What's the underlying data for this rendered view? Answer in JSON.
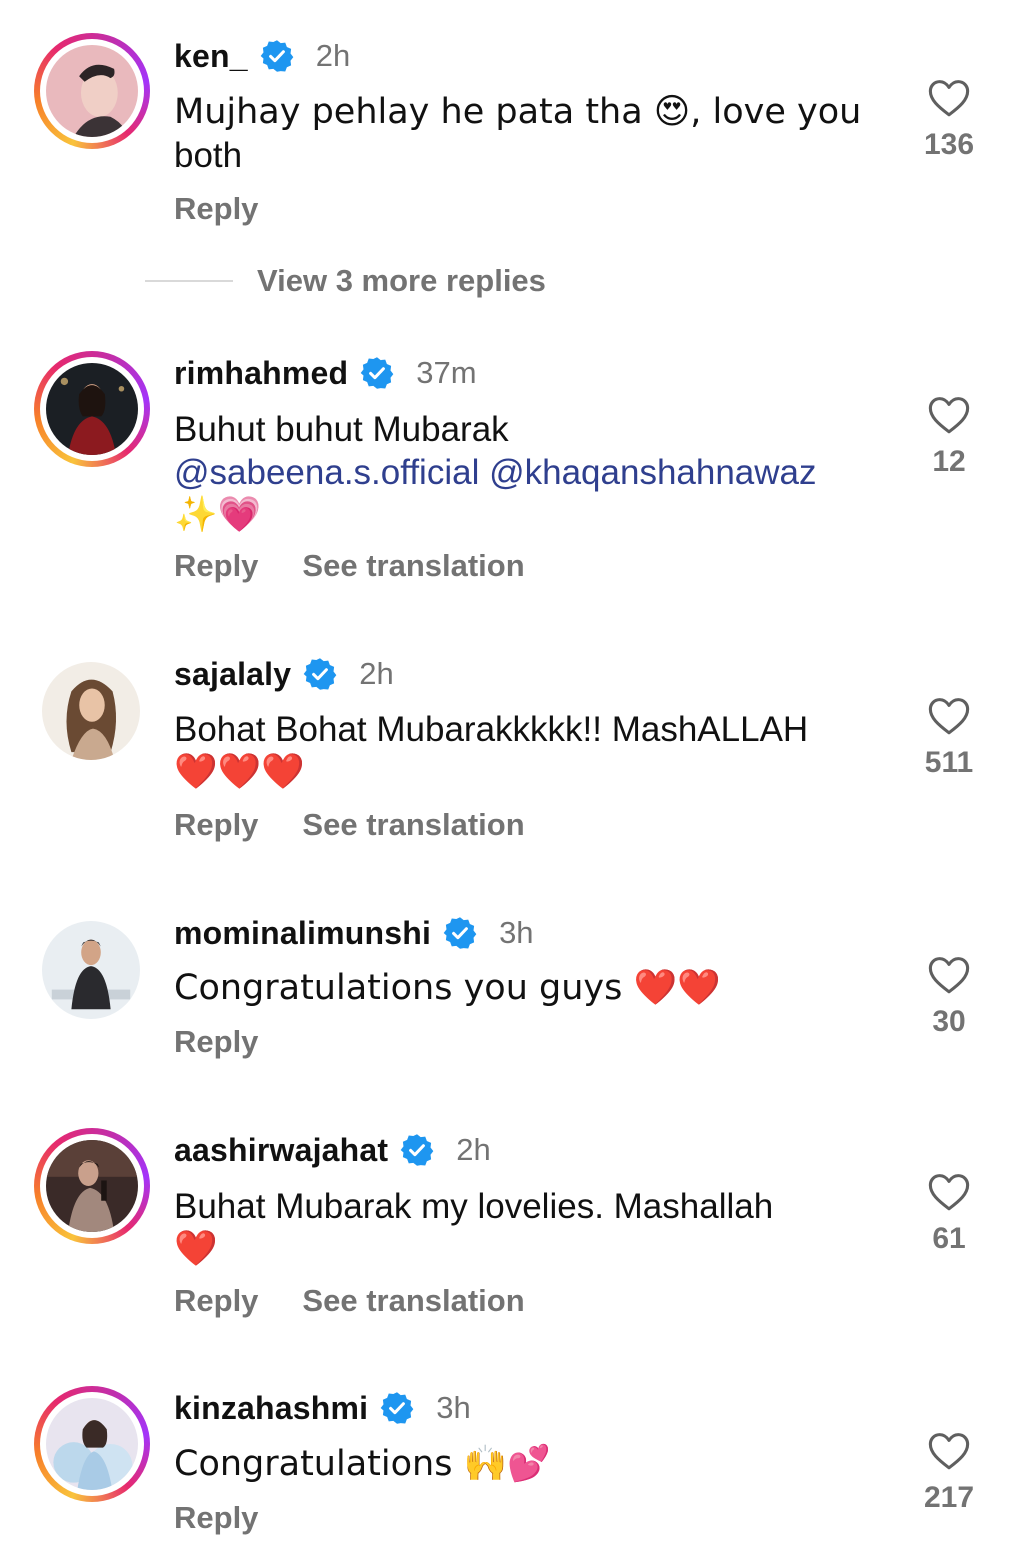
{
  "comments": [
    {
      "username": "ken_",
      "verified": true,
      "time": "2h",
      "text_lines": [
        "Mujhay pehlay he pata tha 😍, love you",
        "both"
      ],
      "reply_label": "Reply",
      "likes": "136",
      "story_ring": true,
      "avatar_colors": [
        "#e9b9bd",
        "#2c2426"
      ]
    },
    {
      "username": "rimhahmed",
      "verified": true,
      "time": "37m",
      "text_line1": "Buhut buhut Mubarak",
      "mention1": "@sabeena.s.official",
      "mention2": "@khaqanshahnawaz",
      "text_line3": "✨💗",
      "reply_label": "Reply",
      "translation_label": "See translation",
      "likes": "12",
      "story_ring": true,
      "avatar_colors": [
        "#1b1f24",
        "#8c1a1f"
      ]
    },
    {
      "username": "sajalaly",
      "verified": true,
      "time": "2h",
      "text_line1": "Bohat Bohat Mubarakkkkk!! MashALLAH",
      "text_line2": "❤️❤️❤️",
      "reply_label": "Reply",
      "translation_label": "See translation",
      "likes": "511",
      "story_ring": false,
      "avatar_colors": [
        "#f2ede6",
        "#6a4a33"
      ]
    },
    {
      "username": "mominalimunshi",
      "verified": true,
      "time": "3h",
      "text_line1": "Congratulations you guys ❤️❤️",
      "reply_label": "Reply",
      "likes": "30",
      "story_ring": false,
      "avatar_colors": [
        "#e9eef2",
        "#2a2a2e"
      ]
    },
    {
      "username": "aashirwajahat",
      "verified": true,
      "time": "2h",
      "text_line1": "Buhat Mubarak my lovelies. Mashallah",
      "text_line2": "❤️",
      "reply_label": "Reply",
      "translation_label": "See translation",
      "likes": "61",
      "story_ring": true,
      "avatar_colors": [
        "#3a2a28",
        "#a2887d"
      ]
    },
    {
      "username": "kinzahashmi",
      "verified": true,
      "time": "3h",
      "text_line1": "Congratulations 🙌💕",
      "reply_label": "Reply",
      "likes": "217",
      "story_ring": true,
      "avatar_colors": [
        "#bcd8ec",
        "#e8e4ef"
      ]
    }
  ],
  "view_more_replies": "View 3 more replies",
  "colors": {
    "verified_blue": "#1e96f0",
    "muted_gray": "#737373",
    "mention_blue": "#2f3f8e",
    "heart_red": "#e0212c"
  },
  "icons": {
    "verified": "verified-badge-icon",
    "like": "heart-outline-icon"
  }
}
